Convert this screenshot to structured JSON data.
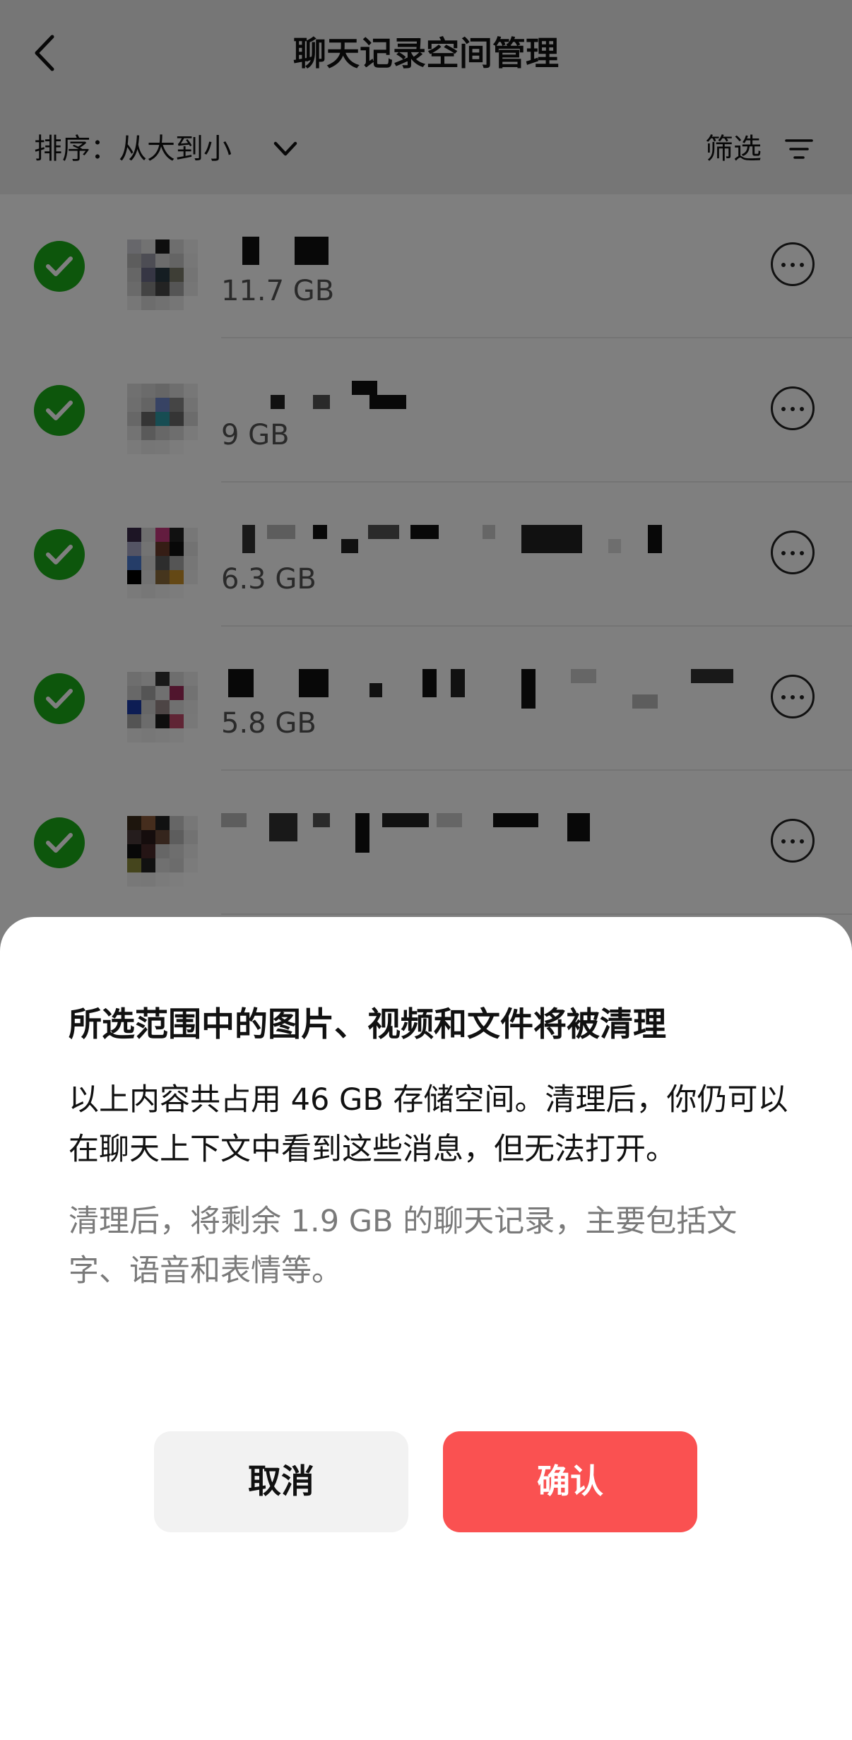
{
  "navbar": {
    "title": "聊天记录空间管理",
    "back_icon": "chevron-left-icon"
  },
  "sortbar": {
    "sort_label": "排序：从大到小",
    "sort_icon": "chevron-down-icon",
    "filter_label": "筛选",
    "filter_icon": "filter-icon"
  },
  "chats": [
    {
      "size": "11.7 GB",
      "selected": true
    },
    {
      "size": "9 GB",
      "selected": true
    },
    {
      "size": "6.3 GB",
      "selected": true
    },
    {
      "size": "5.8 GB",
      "selected": true
    },
    {
      "size": "",
      "selected": true
    }
  ],
  "dialog": {
    "title": "所选范围中的图片、视频和文件将被清理",
    "body": "以上内容共占用 46 GB 存储空间。清理后，你仍可以在聊天上下文中看到这些消息，但无法打开。",
    "note": "清理后，将剩余 1.9 GB 的聊天记录，主要包括文字、语音和表情等。",
    "cancel_label": "取消",
    "confirm_label": "确认"
  },
  "colors": {
    "check_green": "#1aad19",
    "confirm_red": "#fa5151",
    "cancel_bg": "#f2f2f2"
  }
}
